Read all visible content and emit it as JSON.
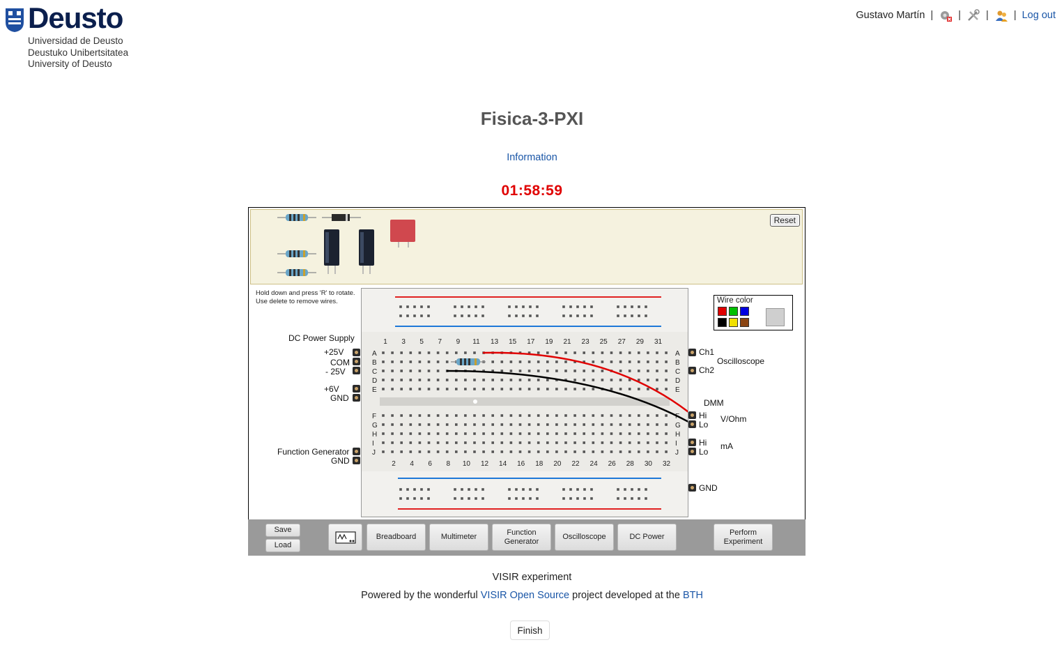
{
  "logo": {
    "name": "Deusto",
    "lines": [
      "Universidad de Deusto",
      "Deustuko Unibertsitatea",
      "University of Deusto"
    ]
  },
  "header": {
    "user": "Gustavo Martín",
    "icons": [
      "status-gear-error-icon",
      "tools-icon",
      "users-icon"
    ],
    "logout": "Log out"
  },
  "page": {
    "title": "Fisica-3-PXI",
    "info_link": "Information",
    "timer": "01:58:59"
  },
  "lab": {
    "reset": "Reset",
    "hint_lines": [
      "Hold down and press 'R' to rotate.",
      "Use delete to remove wires."
    ],
    "dc_power_supply": "DC Power Supply",
    "plus25": "+25V",
    "com": "COM",
    "minus25": "- 25V",
    "plus6": "+6V",
    "gnd": "GND",
    "function_generator": "Function Generator",
    "fg_gnd": "GND",
    "ch1": "Ch1",
    "ch2": "Ch2",
    "oscilloscope": "Oscilloscope",
    "dmm": "DMM",
    "hi": "Hi",
    "lo": "Lo",
    "v_ohm": "V/Ohm",
    "ma": "mA",
    "gnd_right": "GND",
    "wire_color": "Wire color",
    "wire_colors": [
      "#e00000",
      "#00c000",
      "#0000e0",
      "#000000",
      "#f0e000",
      "#8b4513"
    ],
    "row_letters_top": [
      "A",
      "B",
      "C",
      "D",
      "E"
    ],
    "row_letters_bottom": [
      "F",
      "G",
      "H",
      "I",
      "J"
    ],
    "col_numbers_top": [
      "1",
      "3",
      "5",
      "7",
      "9",
      "11",
      "13",
      "15",
      "17",
      "19",
      "21",
      "23",
      "25",
      "27",
      "29",
      "31"
    ],
    "col_numbers_bottom": [
      "2",
      "4",
      "6",
      "8",
      "10",
      "12",
      "14",
      "16",
      "18",
      "20",
      "22",
      "24",
      "26",
      "28",
      "30",
      "32"
    ]
  },
  "toolbar": {
    "save": "Save",
    "load": "Load",
    "breadboard": "Breadboard",
    "multimeter": "Multimeter",
    "function_generator": "Function Generator",
    "oscilloscope": "Oscilloscope",
    "dc_power": "DC Power",
    "perform": "Perform Experiment"
  },
  "footer": {
    "visir": "VISIR experiment",
    "powered_prefix": "Powered by the wonderful",
    "visir_link": "VISIR Open Source",
    "powered_mid": "project developed at the",
    "bth_link": "BTH",
    "finish": "Finish"
  }
}
